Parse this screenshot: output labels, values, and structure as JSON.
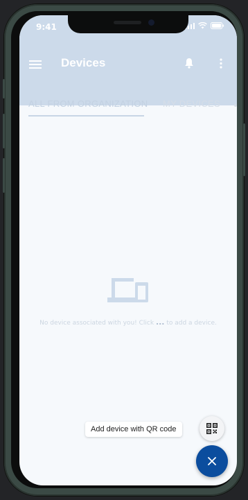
{
  "status_bar": {
    "time": "9:41"
  },
  "app_bar": {
    "title": "Devices",
    "menu_icon": "hamburger-menu-icon",
    "notifications_icon": "bell-icon",
    "more_icon": "more-vertical-icon"
  },
  "tabs": [
    {
      "label": "ALL FROM ORGANIZATION",
      "selected": true
    },
    {
      "label": "MY DEVICES",
      "selected": false
    }
  ],
  "empty_state": {
    "icon": "devices-icon",
    "message_before": "No device associated with you! Click",
    "dots": "...",
    "message_after": "to add a device."
  },
  "actions": {
    "qr_label": "Add device with QR code",
    "qr_icon": "qr-code-icon",
    "close_icon": "close-icon"
  },
  "colors": {
    "app_bar": "#ccdaea",
    "fab": "#0b4d9e",
    "background": "#f6f9fc"
  }
}
